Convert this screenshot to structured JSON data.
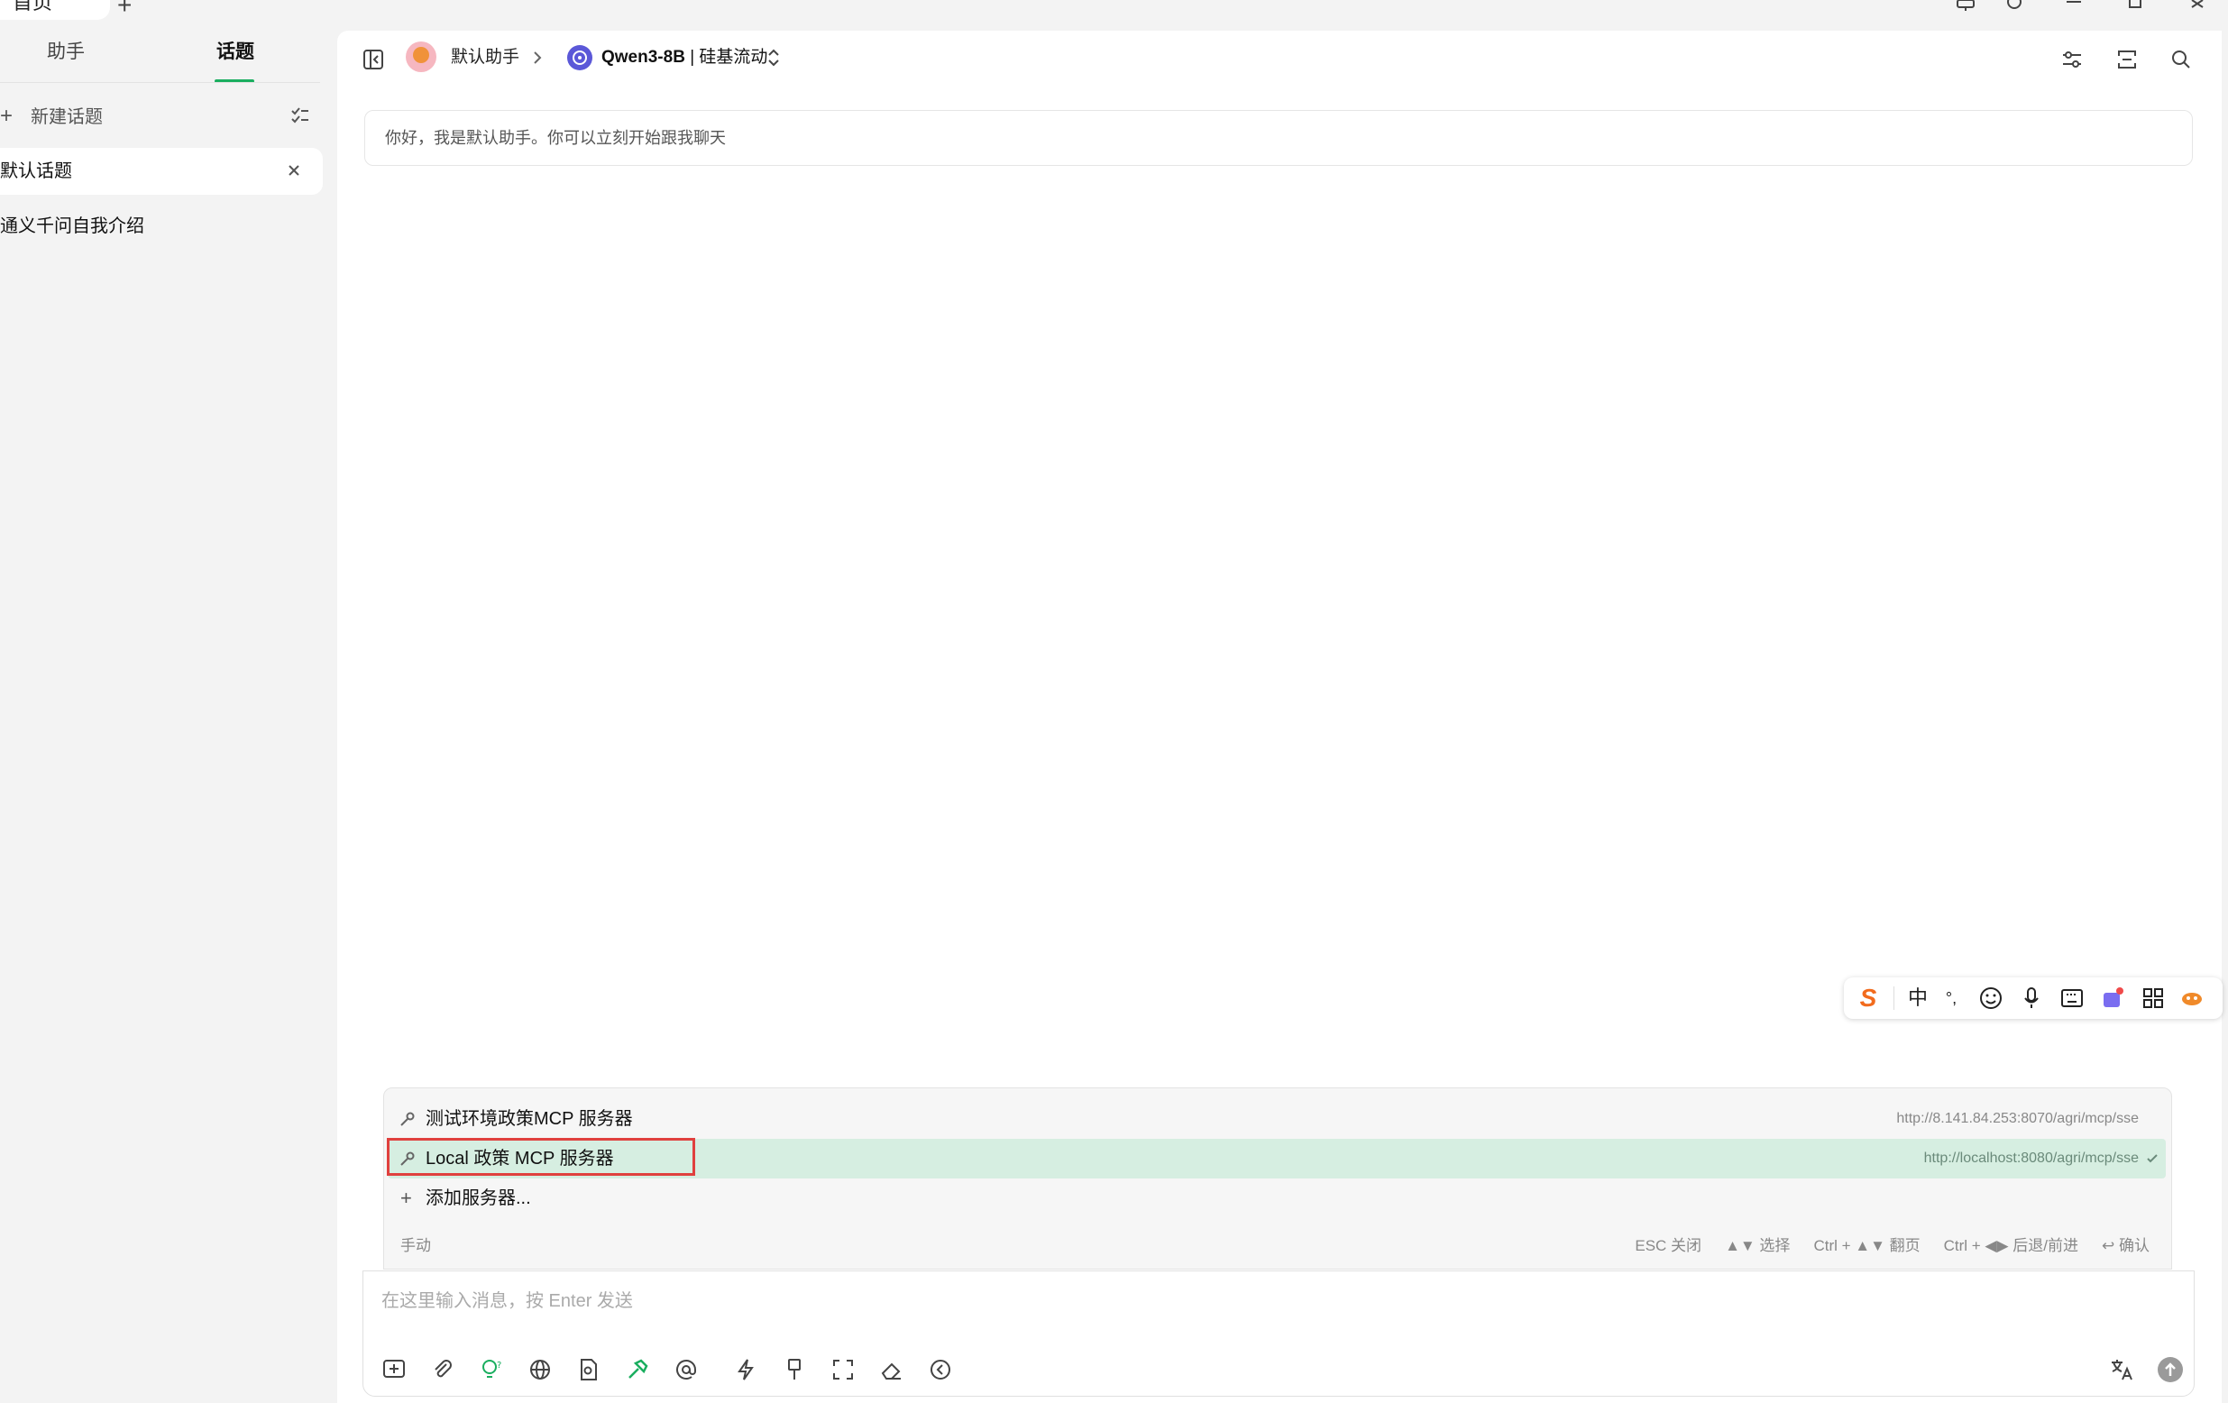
{
  "titlebar": {
    "home_tab": "首页",
    "new_tab": "+"
  },
  "sidebar": {
    "tabs": {
      "assistant": "助手",
      "topics": "话题"
    },
    "new_topic": "新建话题",
    "topics": [
      "默认话题",
      "通义千问自我介绍"
    ]
  },
  "header": {
    "assistant_name": "默认助手",
    "model_name": "Qwen3-8B",
    "model_separator": "|",
    "model_provider": "硅基流动"
  },
  "chat": {
    "welcome": "你好，我是默认助手。你可以立刻开始跟我聊天"
  },
  "ime": {
    "brand": "S",
    "mode": "中",
    "punct": "°,"
  },
  "mcp": {
    "servers": [
      {
        "name": "测试环境政策MCP 服务器",
        "url": "http://8.141.84.253:8070/agri/mcp/sse",
        "selected": false
      },
      {
        "name": "Local 政策 MCP 服务器",
        "url": "http://localhost:8080/agri/mcp/sse",
        "selected": true
      }
    ],
    "add_server": "添加服务器...",
    "mode": "手动",
    "hints": [
      "ESC 关闭",
      "▲▼ 选择",
      "Ctrl + ▲▼ 翻页",
      "Ctrl + ◀▶ 后退/前进",
      "↩ 确认"
    ]
  },
  "input": {
    "placeholder": "在这里输入消息，按 Enter 发送"
  },
  "colors": {
    "accent": "#1aae5f",
    "selected_row": "#d6eee1",
    "highlight_box": "#e0403e"
  }
}
